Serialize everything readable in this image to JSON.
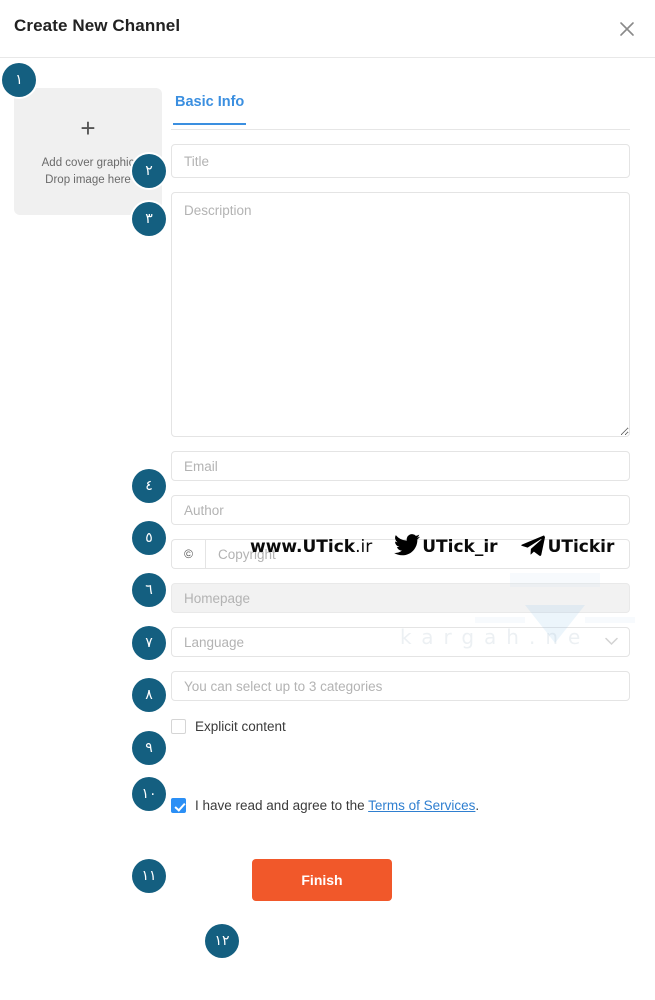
{
  "header": {
    "title": "Create New Channel",
    "close_icon": "close-icon"
  },
  "cover": {
    "plus_icon": "plus-icon",
    "line1": "Add cover graphic",
    "line2": "Drop image here"
  },
  "tabs": [
    {
      "label": "Basic Info",
      "active": true
    }
  ],
  "fields": {
    "title": {
      "placeholder": "Title",
      "value": ""
    },
    "description": {
      "placeholder": "Description",
      "value": ""
    },
    "email": {
      "placeholder": "Email",
      "value": ""
    },
    "author": {
      "placeholder": "Author",
      "value": ""
    },
    "copyright": {
      "addon": "©",
      "placeholder": "Copyright",
      "value": ""
    },
    "homepage": {
      "placeholder": "Homepage",
      "value": ""
    },
    "language": {
      "placeholder": "Language",
      "value": "",
      "chevron_icon": "chevron-down-icon"
    },
    "categories": {
      "placeholder": "You can select up to 3 categories",
      "value": ""
    }
  },
  "checkboxes": {
    "explicit": {
      "label": "Explicit content",
      "checked": false
    },
    "terms": {
      "prefix": "I have read and agree to the ",
      "link": "Terms of Services",
      "suffix": ".",
      "checked": true
    }
  },
  "finish_button": {
    "label": "Finish"
  },
  "badges": [
    {
      "num": "١"
    },
    {
      "num": "٢"
    },
    {
      "num": "٣"
    },
    {
      "num": "٤"
    },
    {
      "num": "٥"
    },
    {
      "num": "٦"
    },
    {
      "num": "٧"
    },
    {
      "num": "٨"
    },
    {
      "num": "٩"
    },
    {
      "num": "١٠"
    },
    {
      "num": "١١"
    },
    {
      "num": "١٢"
    }
  ],
  "watermark": {
    "site": "www.UTick",
    "site_tld": ".ir",
    "twitter_handle": "UTick_ir",
    "telegram_handle": "UTickir",
    "faint": "kargah.ne"
  },
  "colors": {
    "badge": "#145f80",
    "accent_blue": "#3b8fe0",
    "checkbox_blue": "#2b8ff5",
    "finish_orange": "#f1582a",
    "link_blue": "#2f7fd0"
  }
}
